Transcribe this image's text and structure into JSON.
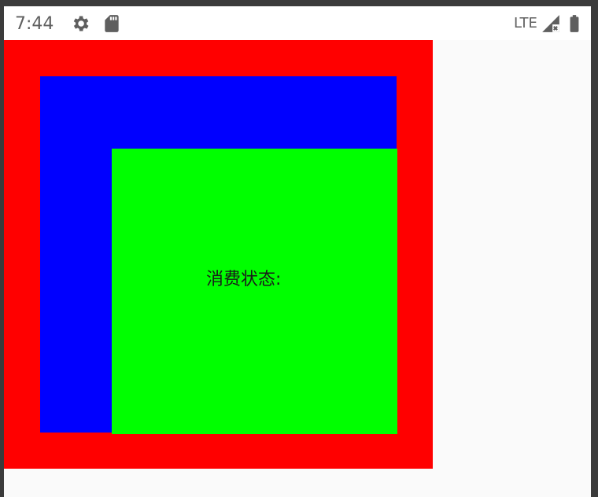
{
  "status_bar": {
    "time": "7:44",
    "network": "LTE",
    "icons": [
      "gear-icon",
      "sd-card-icon",
      "signal-icon",
      "battery-icon"
    ]
  },
  "layout_colors": {
    "outer": "#ff0000",
    "middle": "#0000ff",
    "inner": "#00ff00",
    "background": "#fafafa"
  },
  "main": {
    "status_label": "消费状态:"
  }
}
